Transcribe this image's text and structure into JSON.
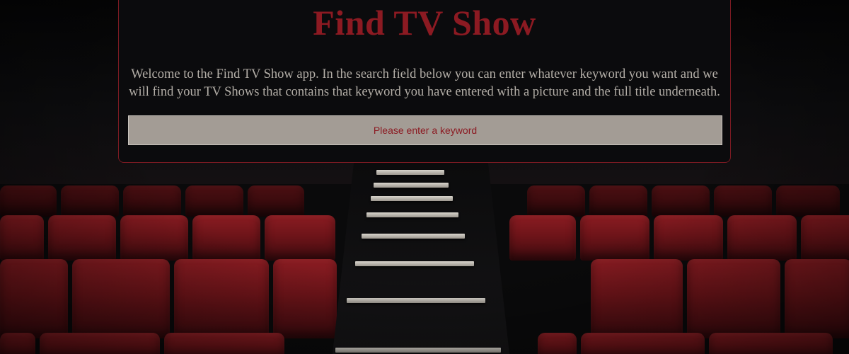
{
  "app": {
    "title": "Find TV Show",
    "intro": "Welcome to the Find TV Show app. In the search field below you can enter whatever keyword you want and we will find your TV Shows that contains that keyword you have entered with a picture and the full title underneath."
  },
  "search": {
    "value": "",
    "placeholder": "Please enter a keyword"
  },
  "colors": {
    "accent": "#8c1a22",
    "card_background": "#0b0b0d",
    "input_background": "#a39c95",
    "intro_text": "#b3aea7"
  },
  "background": {
    "image": "cinema-seats-background"
  }
}
